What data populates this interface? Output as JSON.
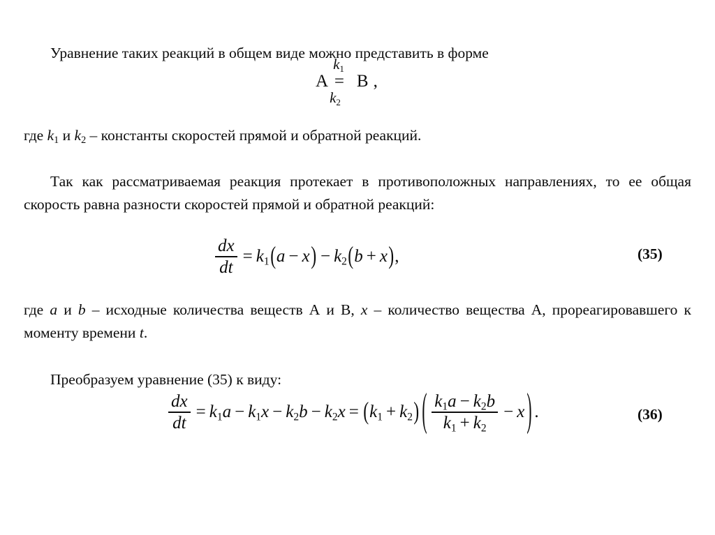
{
  "document": {
    "language": "ru",
    "background_color": "#ffffff",
    "text_color": "#0c0c0c"
  },
  "paragraphs": {
    "intro": "Уравнение таких реакций в общем виде можно представить в форме",
    "where_k": {
      "lead": "где ",
      "k1": "k",
      "k1_sub": "1",
      "and": " и ",
      "k2": "k",
      "k2_sub": "2",
      "tail": " – константы скоростей прямой и обратной реакций."
    },
    "since": "Так как рассматриваемая реакция протекает в противоположных направлениях, то ее общая скорость равна разности скоростей прямой и обратной реакций:",
    "where_ab": {
      "lead": "где ",
      "a": "a",
      "and1": " и ",
      "b": "b",
      "mid1": " – исходные количества веществ А и В, ",
      "x": "x",
      "mid2": " – количество вещества А, прореагировавшего к моменту времени ",
      "t": "t",
      "end": "."
    },
    "transform": "Преобразуем уравнение (35) к виду:"
  },
  "reaction_scheme": {
    "reactant": "А",
    "product": "В",
    "arrow": "=",
    "rate_forward": "k",
    "rate_forward_sub": "1",
    "rate_reverse": "k",
    "rate_reverse_sub": "2",
    "trailing_punctuation": ","
  },
  "equations": [
    {
      "number": "(35)",
      "latex": "\\frac{dx}{dt} = k_1(a-x) - k_2(b+x),",
      "parts": {
        "num": "dx",
        "den": "dt",
        "eq": "=",
        "k": "k",
        "s1": "1",
        "s2": "2",
        "lpar": "(",
        "rpar": ")",
        "a": "a",
        "b": "b",
        "x": "x",
        "minus": "−",
        "plus": "+",
        "comma": ","
      }
    },
    {
      "number": "(36)",
      "latex": "\\frac{dx}{dt} = k_1a - k_1x - k_2b - k_2x = (k_1+k_2)\\left(\\frac{k_1a-k_2b}{k_1+k_2}-x\\right).",
      "parts": {
        "num": "dx",
        "den": "dt",
        "eq": "=",
        "k": "k",
        "s1": "1",
        "s2": "2",
        "a": "a",
        "b": "b",
        "x": "x",
        "minus": "−",
        "plus": "+",
        "lpar": "(",
        "rpar": ")",
        "period": "."
      }
    }
  ]
}
